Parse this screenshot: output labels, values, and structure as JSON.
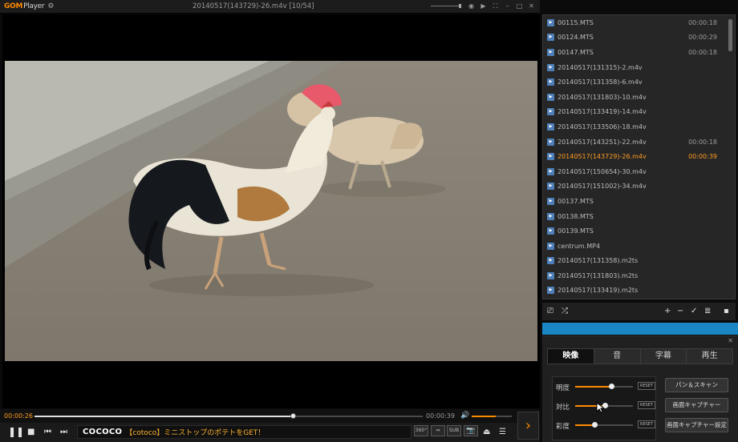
{
  "app": {
    "logo_brand": "GOM",
    "logo_product": "Player"
  },
  "window": {
    "title": "20140517(143729)-26.m4v  [10/54]"
  },
  "seek": {
    "current_time": "00:00:26",
    "total_time": "00:00:39",
    "progress": 0.667,
    "volume": 0.6
  },
  "ad": {
    "brand": "COCOCO",
    "text": "【cotoco】ミニストップのポテトをGET！"
  },
  "subtitle_buttons": {
    "sub": "SUB"
  },
  "playlist": {
    "items": [
      {
        "name": "00115.MTS",
        "duration": "00:00:18"
      },
      {
        "name": "00124.MTS",
        "duration": "00:00:29"
      },
      {
        "name": "00147.MTS",
        "duration": "00:00:18"
      },
      {
        "name": "20140517(131315)-2.m4v",
        "duration": ""
      },
      {
        "name": "20140517(131358)-6.m4v",
        "duration": ""
      },
      {
        "name": "20140517(131803)-10.m4v",
        "duration": ""
      },
      {
        "name": "20140517(133419)-14.m4v",
        "duration": ""
      },
      {
        "name": "20140517(133506)-18.m4v",
        "duration": ""
      },
      {
        "name": "20140517(143251)-22.m4v",
        "duration": "00:00:18"
      },
      {
        "name": "20140517(143729)-26.m4v",
        "duration": "00:00:39",
        "active": true
      },
      {
        "name": "20140517(150654)-30.m4v",
        "duration": ""
      },
      {
        "name": "20140517(151002)-34.m4v",
        "duration": ""
      },
      {
        "name": "00137.MTS",
        "duration": ""
      },
      {
        "name": "00138.MTS",
        "duration": ""
      },
      {
        "name": "00139.MTS",
        "duration": ""
      },
      {
        "name": "centrum.MP4",
        "duration": ""
      },
      {
        "name": "20140517(131358).m2ts",
        "duration": ""
      },
      {
        "name": "20140517(131803).m2ts",
        "duration": ""
      },
      {
        "name": "20140517(133419).m2ts",
        "duration": ""
      }
    ]
  },
  "control_panel": {
    "tabs": [
      "映像",
      "音",
      "字幕",
      "再生"
    ],
    "active_tab": "映像",
    "sliders": [
      {
        "label": "明度",
        "value": 0.62,
        "reset": "RESET"
      },
      {
        "label": "対比",
        "value": 0.52,
        "reset": "RESET"
      },
      {
        "label": "彩度",
        "value": 0.33,
        "reset": "RESET"
      }
    ],
    "buttons": [
      "パン＆スキャン",
      "画面キャプチャー",
      "画面キャプチャー設定"
    ]
  },
  "colors": {
    "accent": "#ff8a00",
    "panel_blue": "#1a86c4"
  }
}
